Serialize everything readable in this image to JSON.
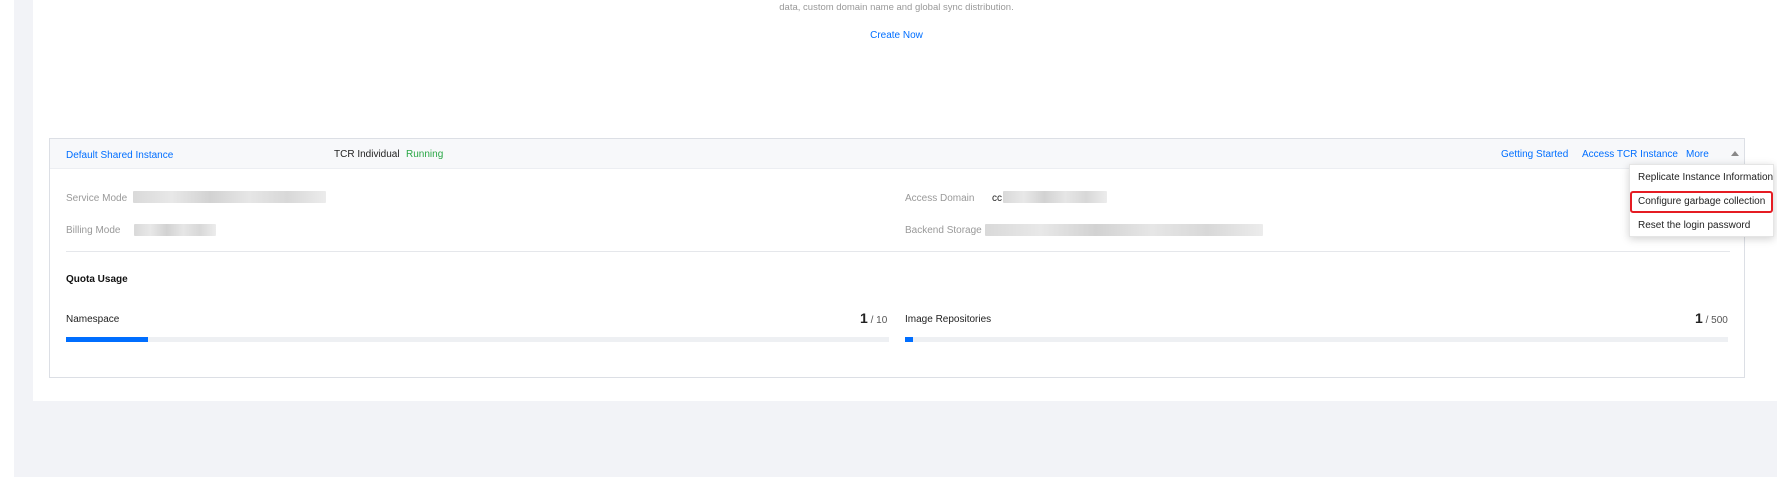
{
  "promo": {
    "description": "data, custom domain name and global sync distribution.",
    "create_link": "Create Now"
  },
  "instance": {
    "name": "Default Shared Instance",
    "edition": "TCR Individual",
    "status": "Running",
    "status_color": "#29a745",
    "links": {
      "getting_started": "Getting Started",
      "access": "Access TCR Instance",
      "more": "More"
    },
    "info": {
      "service_mode_label": "Service Mode",
      "billing_mode_label": "Billing Mode",
      "access_domain_label": "Access Domain",
      "access_domain_value_prefix": "cc",
      "backend_storage_label": "Backend Storage"
    },
    "quota": {
      "title": "Quota Usage",
      "namespace": {
        "label": "Namespace",
        "used": "1",
        "limit": "/ 10",
        "ratio": 0.1
      },
      "repositories": {
        "label": "Image Repositories",
        "used": "1",
        "limit": "/ 500",
        "ratio": 0.01
      }
    }
  },
  "more_menu": {
    "items": [
      "Replicate Instance Information",
      "Configure garbage collection",
      "Reset the login password"
    ],
    "highlighted_index": 1
  },
  "colors": {
    "accent": "#006eff",
    "page_background": "#f2f3f7",
    "highlight_border": "#e51c23"
  },
  "icons": {
    "more_toggle": "caret-up-icon"
  }
}
